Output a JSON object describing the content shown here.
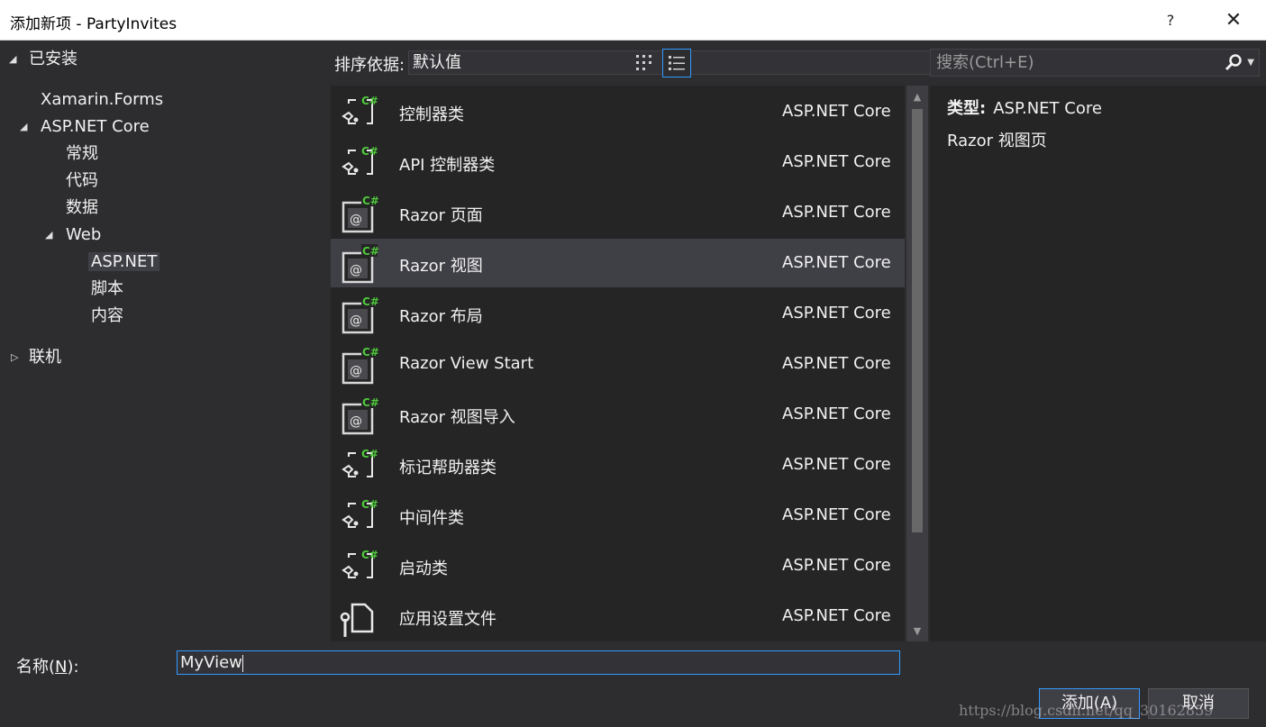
{
  "window": {
    "title": "添加新项 - PartyInvites",
    "help": "?",
    "close": "✕"
  },
  "tree": {
    "installed": "已安装",
    "xamarin": "Xamarin.Forms",
    "aspnet_core": "ASP.NET Core",
    "general": "常规",
    "code": "代码",
    "data": "数据",
    "web": "Web",
    "aspnet": "ASP.NET",
    "script": "脚本",
    "content": "内容",
    "online": "联机"
  },
  "toolbar": {
    "sort_label": "排序依据:",
    "sort_value": "默认值",
    "search_placeholder": "搜索(Ctrl+E)"
  },
  "templates": [
    {
      "name": "控制器类",
      "category": "ASP.NET Core",
      "icon": "csharp-class-icon"
    },
    {
      "name": "API 控制器类",
      "category": "ASP.NET Core",
      "icon": "csharp-class-icon"
    },
    {
      "name": "Razor 页面",
      "category": "ASP.NET Core",
      "icon": "razor-icon"
    },
    {
      "name": "Razor 视图",
      "category": "ASP.NET Core",
      "icon": "razor-icon"
    },
    {
      "name": "Razor 布局",
      "category": "ASP.NET Core",
      "icon": "razor-icon"
    },
    {
      "name": "Razor View Start",
      "category": "ASP.NET Core",
      "icon": "razor-icon"
    },
    {
      "name": "Razor 视图导入",
      "category": "ASP.NET Core",
      "icon": "razor-icon"
    },
    {
      "name": "标记帮助器类",
      "category": "ASP.NET Core",
      "icon": "csharp-class-icon"
    },
    {
      "name": "中间件类",
      "category": "ASP.NET Core",
      "icon": "csharp-class-icon"
    },
    {
      "name": "启动类",
      "category": "ASP.NET Core",
      "icon": "csharp-class-icon"
    },
    {
      "name": "应用设置文件",
      "category": "ASP.NET Core",
      "icon": "settings-file-icon"
    }
  ],
  "selected_index": 3,
  "detail": {
    "type_label": "类型:",
    "type_value": "ASP.NET Core",
    "description": "Razor 视图页"
  },
  "bottom": {
    "name_label_pre": "名称(",
    "name_label_key": "N",
    "name_label_post": "):",
    "name_value": "MyView",
    "add_button": "添加(A)",
    "cancel_button": "取消"
  },
  "watermark": "https://blog.csdn.net/qq_30162859",
  "colors": {
    "accent": "#3399ff",
    "background": "#2d2d30",
    "panel": "#252526",
    "selected": "#3f3f46",
    "csharp_green": "#4ec93a"
  }
}
